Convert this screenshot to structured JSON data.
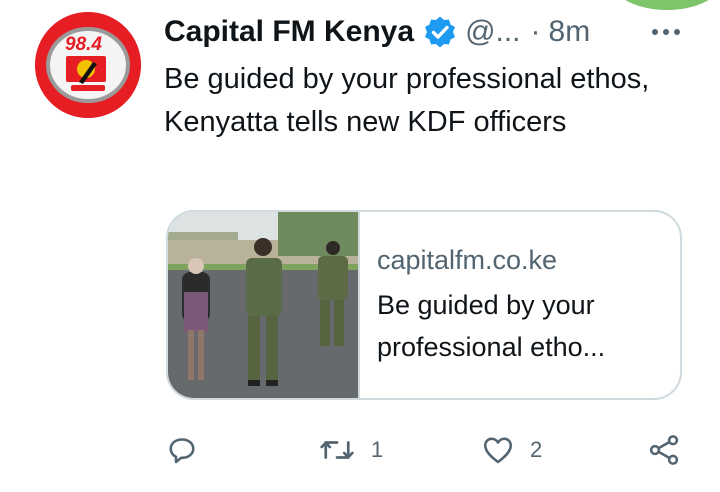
{
  "tweet": {
    "author": {
      "name": "Capital FM Kenya",
      "handle": "@...",
      "verified": true,
      "avatar_text": "98.4"
    },
    "separator": "·",
    "time": "8m",
    "text": "Be guided by your professional ethos, Kenyatta tells new KDF officers",
    "card": {
      "domain": "capitalfm.co.ke",
      "title": "Be guided by your professional etho..."
    },
    "actions": {
      "reply": {
        "icon": "reply-icon"
      },
      "retweet": {
        "icon": "retweet-icon",
        "count": "1"
      },
      "like": {
        "icon": "heart-icon",
        "count": "2"
      },
      "share": {
        "icon": "share-icon"
      }
    }
  },
  "colors": {
    "text_primary": "#0f1419",
    "text_secondary": "#536471",
    "verified_blue": "#1d9bf0",
    "avatar_red": "#e61e24",
    "card_border": "#cfd9de"
  }
}
